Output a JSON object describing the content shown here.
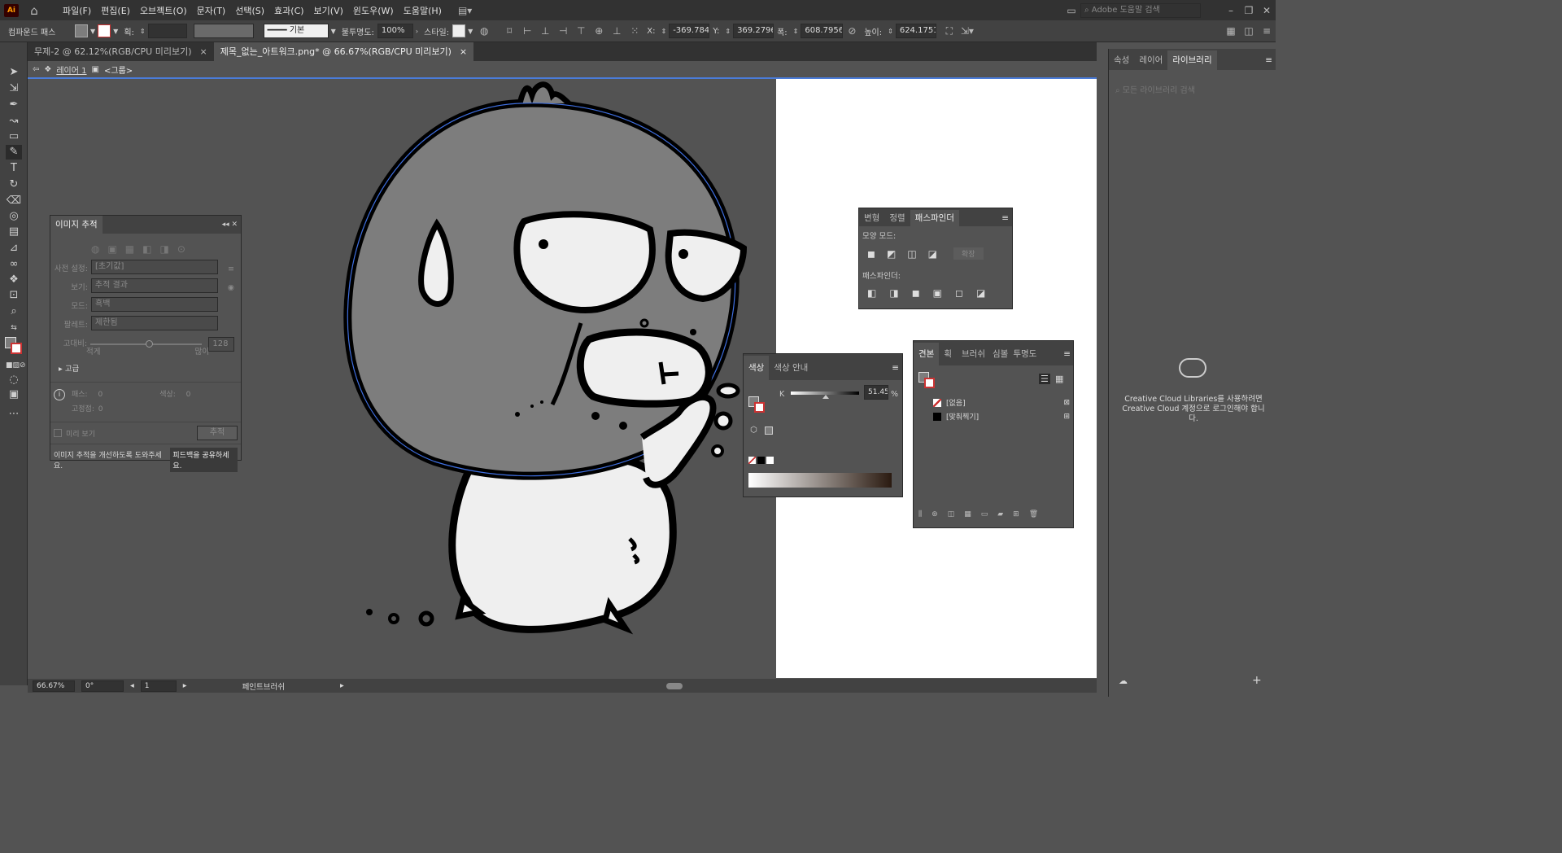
{
  "menubar": {
    "logo": "Ai",
    "items": [
      "파일(F)",
      "편집(E)",
      "오브젝트(O)",
      "문자(T)",
      "선택(S)",
      "효과(C)",
      "보기(V)",
      "윈도우(W)",
      "도움말(H)"
    ],
    "search_placeholder": "Adobe 도움말 검색"
  },
  "control": {
    "selection_type": "컴파운드 패스",
    "stroke_label": "획:",
    "stroke_style": "기본",
    "opacity_label": "불투명도:",
    "opacity": "100%",
    "style_label": "스타일:",
    "x_label": "X:",
    "x": "-369.7841",
    "y_label": "Y:",
    "y": "369.2796 p",
    "w_label": "폭:",
    "w": "608.7956 p",
    "h_label": "높이:",
    "h": "624.1751 p"
  },
  "tabs": [
    {
      "label": "무제-2 @ 62.12%(RGB/CPU 미리보기)",
      "close": "×"
    },
    {
      "label": "제목_없는_아트워크.png* @ 66.67%(RGB/CPU 미리보기)",
      "close": "×"
    }
  ],
  "breadcrumb": {
    "layer": "레이어 1",
    "group": "<그룹>"
  },
  "image_trace": {
    "title": "이미지 추적",
    "preset_label": "사전 설정:",
    "preset": "[초기값]",
    "view_label": "보기:",
    "view": "추적 결과",
    "mode_label": "모드:",
    "mode": "흑백",
    "palette_label": "팔레트:",
    "palette": "제한됨",
    "threshold_label": "고대비:",
    "threshold": "128",
    "less": "적게",
    "more": "많이",
    "advanced": "고급",
    "paths_label": "패스:",
    "paths": "0",
    "colors_label": "색상:",
    "colors": "0",
    "anchors_label": "고정점:",
    "anchors": "0",
    "preview": "미리 보기",
    "trace_button": "추적",
    "feedback_text": "이미지 추적을 개선하도록 도와주세요.",
    "feedback_button": "피드백을 공유하세요."
  },
  "pathfinder": {
    "tabs": [
      "변형",
      "정렬",
      "패스파인더"
    ],
    "shape_modes": "모양 모드:",
    "expand": "확장",
    "pathfinders": "패스파인더:"
  },
  "color": {
    "tabs": [
      "색상",
      "색상 안내"
    ],
    "channel": "K",
    "value": "51.45",
    "unit": "%",
    "k_level": 0.5145
  },
  "swatches": {
    "tabs": [
      "견본",
      "획",
      "브러쉬",
      "심볼",
      "투명도"
    ],
    "items": [
      {
        "name": "[없음]"
      },
      {
        "name": "[맞춰찍기]"
      }
    ]
  },
  "right_panel": {
    "tabs": [
      "속성",
      "레이어",
      "라이브러리"
    ],
    "search_placeholder": "모든 라이브러리 검색",
    "message": "Creative Cloud Libraries를 사용하려면 Creative Cloud 계정으로 로그인해야 합니다."
  },
  "status": {
    "zoom": "66.67%",
    "rotation": "0°",
    "artboard": "1",
    "tool": "페인트브러쉬"
  },
  "colors": {
    "path_highlight": "#3f6fe0",
    "face_gray": "#7d7d7d",
    "body_white": "#efefef"
  }
}
